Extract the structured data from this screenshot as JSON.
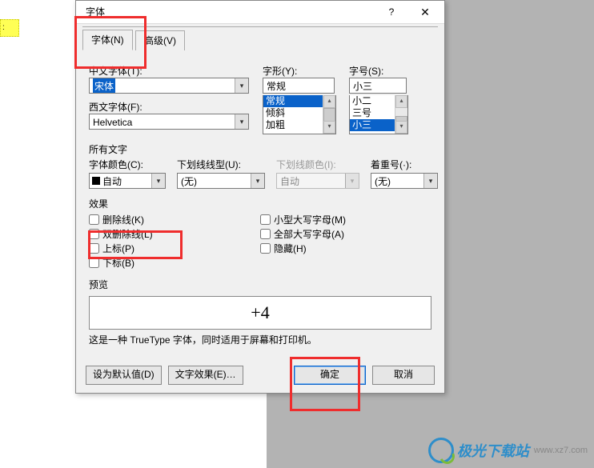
{
  "left_tag": ":",
  "dialog": {
    "title": "字体",
    "help": "?",
    "close": "✕",
    "tabs": {
      "font": "字体(N)",
      "advanced": "高级(V)"
    },
    "labels": {
      "cjk_font": "中文字体(T):",
      "latin_font": "西文字体(F):",
      "style": "字形(Y):",
      "size": "字号(S):",
      "all_text": "所有文字",
      "font_color": "字体颜色(C):",
      "ul_style": "下划线线型(U):",
      "ul_color": "下划线颜色(I):",
      "emphasis": "着重号(·):",
      "effects": "效果",
      "preview": "预览"
    },
    "values": {
      "cjk_font": "宋体",
      "latin_font": "Helvetica",
      "style": "常规",
      "size": "小三",
      "font_color": "自动",
      "ul_style": "(无)",
      "ul_color": "自动",
      "emphasis": "(无)"
    },
    "style_list": [
      "常规",
      "倾斜",
      "加粗"
    ],
    "size_list": [
      "小二",
      "三号",
      "小三"
    ],
    "effects_checks": {
      "strike": "删除线(K)",
      "dbl_strike": "双删除线(L)",
      "superscript": "上标(P)",
      "subscript": "下标(B)",
      "smallcaps": "小型大写字母(M)",
      "allcaps": "全部大写字母(A)",
      "hidden": "隐藏(H)"
    },
    "preview_text": "+4",
    "hint_text": "这是一种 TrueType 字体，同时适用于屏幕和打印机。",
    "buttons": {
      "set_default": "设为默认值(D)",
      "text_effects": "文字效果(E)…",
      "ok": "确定",
      "cancel": "取消"
    }
  },
  "watermark": {
    "brand": "极光下载站",
    "url": "www.xz7.com"
  }
}
